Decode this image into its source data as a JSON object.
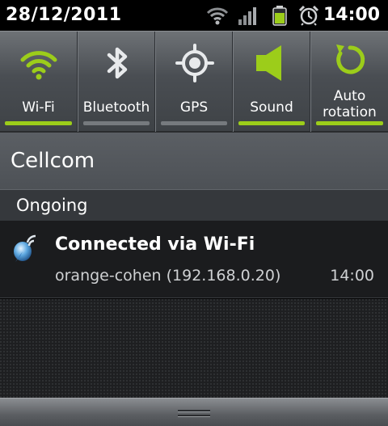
{
  "status_bar": {
    "date": "28/12/2011",
    "time": "14:00",
    "icons": [
      "wifi-signal-icon",
      "cell-signal-icon",
      "battery-icon",
      "alarm-clock-icon"
    ],
    "battery_color": "#9ccd1a"
  },
  "quick_settings": {
    "accent_on": "#9ccd1a",
    "accent_off": "#767a7e",
    "tiles": [
      {
        "label": "Wi-Fi",
        "icon": "wifi-icon",
        "enabled": true
      },
      {
        "label": "Bluetooth",
        "icon": "bluetooth-icon",
        "enabled": false
      },
      {
        "label": "GPS",
        "icon": "gps-icon",
        "enabled": false
      },
      {
        "label": "Sound",
        "icon": "speaker-icon",
        "enabled": true
      },
      {
        "label_line1": "Auto",
        "label_line2": "rotation",
        "icon": "auto-rotate-icon",
        "enabled": true
      }
    ]
  },
  "carrier": {
    "name": "Cellcom"
  },
  "ongoing_section": {
    "title": "Ongoing"
  },
  "notifications": [
    {
      "icon": "wifi-connected-notification-icon",
      "title": "Connected via Wi-Fi",
      "text": "orange-cohen (192.168.0.20)",
      "time": "14:00"
    }
  ]
}
